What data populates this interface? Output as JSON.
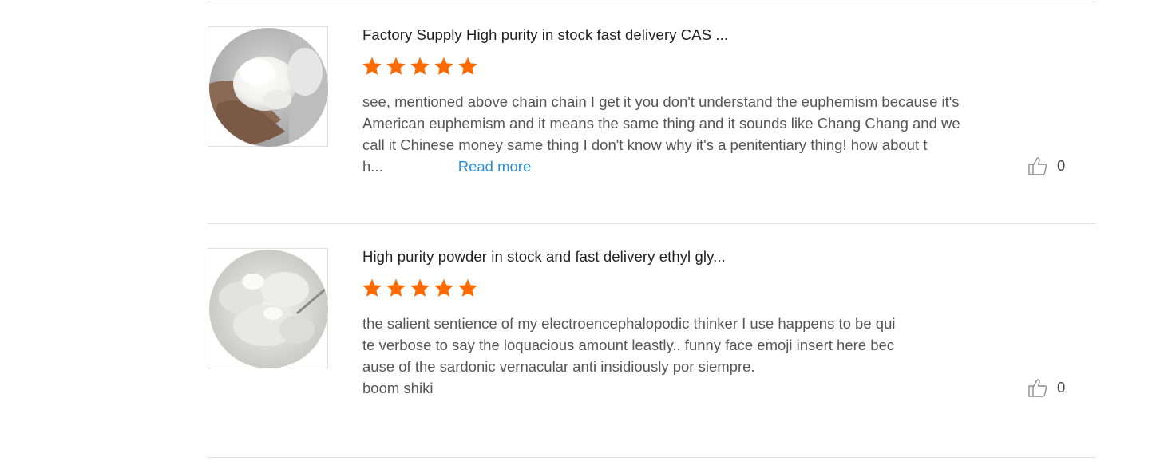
{
  "reviews": [
    {
      "title": "Factory Supply High purity in stock fast delivery CAS ...",
      "rating": 5,
      "body_lines": [
        "see, mentioned above chain chain I get it you don't understand the euphemism because it's",
        "American euphemism and it means the same thing and it sounds like Chang Chang and we",
        "call it Chinese money same thing I don't know why it's a penitentiary thing! how about t",
        "h..."
      ],
      "read_more_label": "Read more",
      "likes": "0",
      "image_icon": "white-powder-in-hand-image"
    },
    {
      "title": "High purity powder in stock and fast delivery ethyl gly...",
      "rating": 5,
      "body_lines": [
        "the salient sentience of my electroencephalopodic thinker I use happens to be qui",
        "te verbose to say the loquacious amount leastly.. funny face emoji insert here bec",
        "ause of the sardonic vernacular anti insidiously por siempre.",
        "boom shiki"
      ],
      "likes": "0",
      "image_icon": "white-powder-pile-image"
    }
  ],
  "colors": {
    "star": "#ff6a00",
    "link": "#2a8fd4",
    "divider": "#e3e3e3"
  }
}
